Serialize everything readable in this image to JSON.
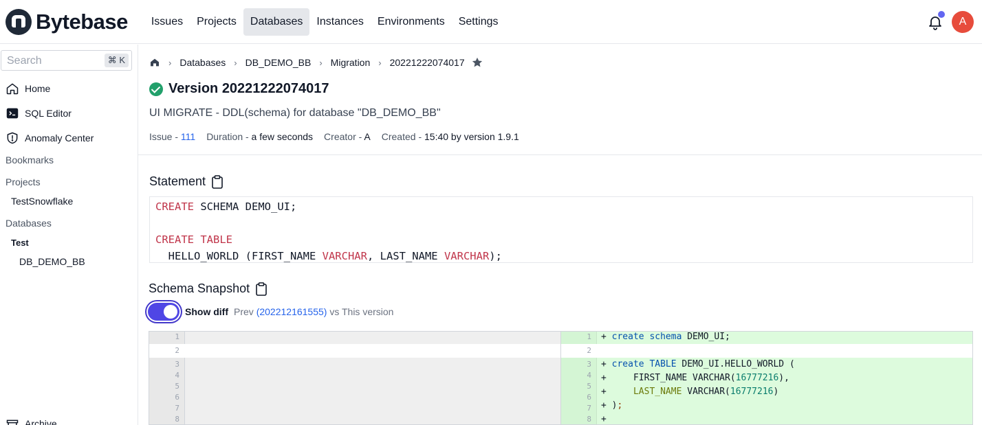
{
  "app": {
    "name": "Bytebase"
  },
  "nav": [
    "Issues",
    "Projects",
    "Databases",
    "Instances",
    "Environments",
    "Settings"
  ],
  "nav_active": "Databases",
  "user": {
    "avatar_letter": "A"
  },
  "sidebar": {
    "search_placeholder": "Search",
    "shortcut": "⌘ K",
    "links": [
      {
        "label": "Home",
        "icon": "home-icon"
      },
      {
        "label": "SQL Editor",
        "icon": "terminal-icon"
      },
      {
        "label": "Anomaly Center",
        "icon": "shield-icon"
      }
    ],
    "bookmarks": "Bookmarks",
    "projects_label": "Projects",
    "projects": [
      "TestSnowflake"
    ],
    "databases_label": "Databases",
    "env_group": "Test",
    "databases": [
      "DB_DEMO_BB"
    ],
    "archive": "Archive"
  },
  "breadcrumb": [
    "Databases",
    "DB_DEMO_BB",
    "Migration",
    "20221222074017"
  ],
  "page": {
    "title": "Version 20221222074017",
    "subtitle": "UI MIGRATE - DDL(schema) for database \"DB_DEMO_BB\"",
    "meta": {
      "issue_key": "Issue - ",
      "issue_value": "111",
      "duration_key": "Duration - ",
      "duration_value": "a few seconds",
      "creator_key": "Creator - ",
      "creator_value": "A",
      "created_key": "Created - ",
      "created_value": "15:40 by version 1.9.1"
    }
  },
  "statement": {
    "title": "Statement",
    "lines": [
      {
        "kw": "CREATE",
        "rest": " SCHEMA DEMO_UI;"
      },
      {
        "kw": "",
        "rest": ""
      },
      {
        "kw": "CREATE TABLE",
        "rest": ""
      },
      {
        "kw": "",
        "rest": "  HELLO_WORLD (FIRST_NAME VARCHAR, LAST_NAME VARCHAR);"
      }
    ]
  },
  "schema_snapshot": {
    "title": "Schema Snapshot",
    "show_diff_label": "Show diff",
    "show_diff_on": true,
    "prev_prefix": "Prev ",
    "prev_version": "(202212161555)",
    "vs_text": " vs This version"
  },
  "diff": {
    "line_numbers": [
      "1",
      "2",
      "3",
      "4",
      "5",
      "6",
      "7",
      "8"
    ],
    "right_lines": [
      "+ create schema DEMO_UI;",
      "",
      "+ create TABLE DEMO_UI.HELLO_WORLD (",
      "+     FIRST_NAME VARCHAR(16777216),",
      "+     LAST_NAME VARCHAR(16777216)",
      "+ );",
      "+"
    ]
  },
  "colors": {
    "accent": "#4f46e5",
    "success": "#22a06b",
    "keyword": "#c0354a",
    "diff_added_bg": "#ddfbdd",
    "avatar": "#e74c3c"
  }
}
